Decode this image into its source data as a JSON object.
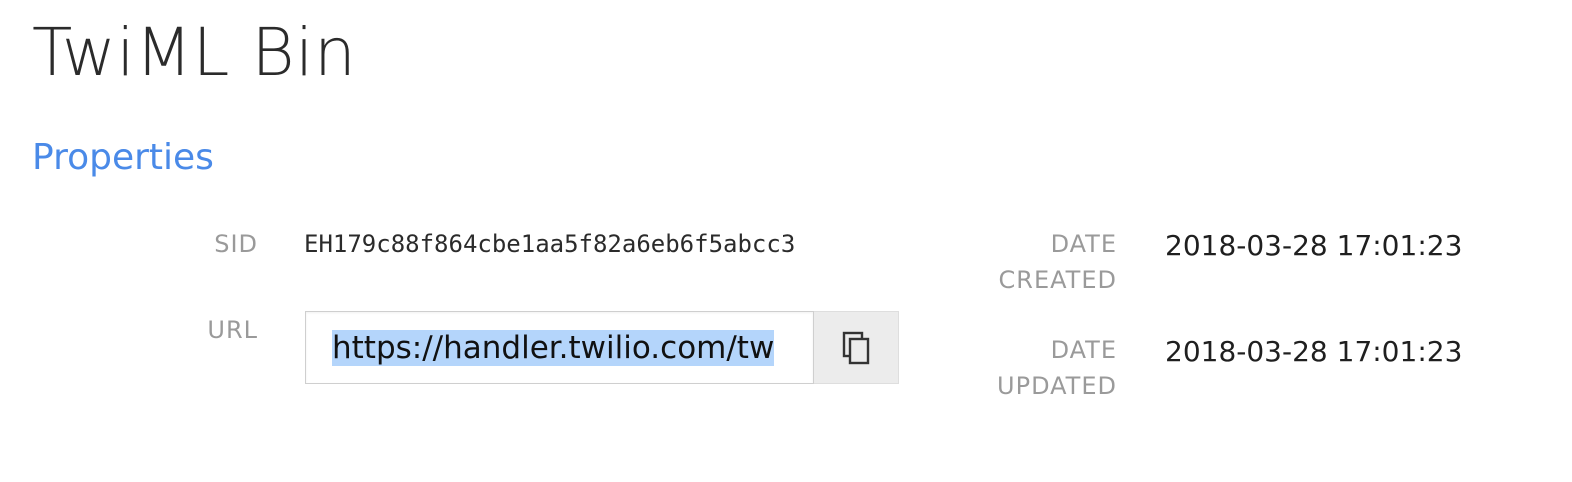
{
  "page": {
    "title": "TwiML Bin",
    "section_title": "Properties"
  },
  "properties": {
    "sid_label": "SID",
    "sid_value": "EH179c88f864cbe1aa5f82a6eb6f5abcc3",
    "url_label": "URL",
    "url_value": "https://handler.twilio.com/tw",
    "copy_icon": "copy-icon",
    "date_created_label": "DATE CREATED",
    "date_created_value": "2018-03-28 17:01:23",
    "date_updated_label": "DATE UPDATED",
    "date_updated_value": "2018-03-28 17:01:23"
  },
  "colors": {
    "accent": "#4a8ae8",
    "selection": "#b4d5fb",
    "label": "#9a9a9a"
  }
}
